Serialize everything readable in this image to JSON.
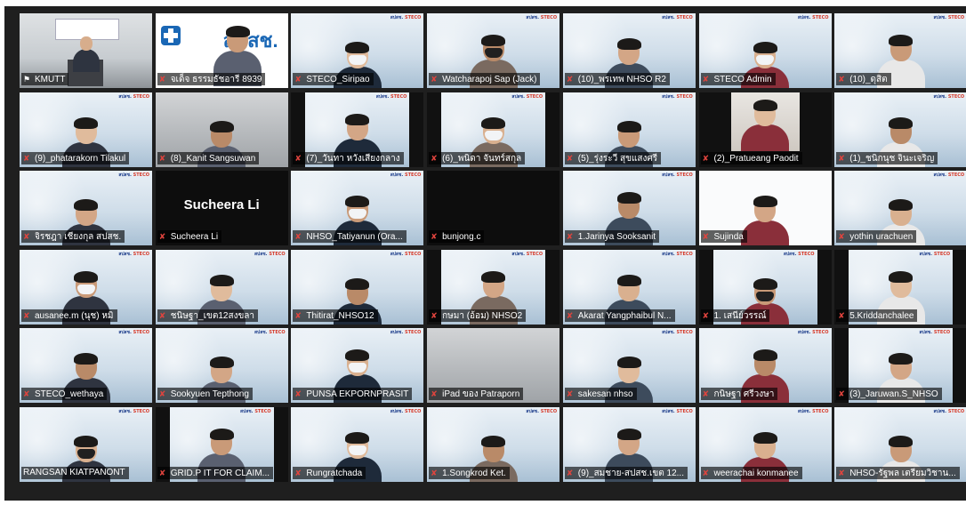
{
  "meeting": {
    "participants": [
      {
        "name": "KMUTT",
        "muted": false,
        "pinned": true,
        "speaking": true,
        "video": "room"
      },
      {
        "name": "จเด็จ ธรรมธัชอารี 8939",
        "muted": true,
        "video": "nhso-logo"
      },
      {
        "name": "STECO_Siripao",
        "muted": true,
        "video": "bg-mask"
      },
      {
        "name": "Watcharapoj Sap (Jack)",
        "muted": true,
        "video": "bg-blackmask"
      },
      {
        "name": "(10)_พรเทพ NHSO R2",
        "muted": true,
        "video": "bg-person"
      },
      {
        "name": "STECO Admin",
        "muted": true,
        "video": "bg-mask"
      },
      {
        "name": "(10)_ดุสิต",
        "muted": true,
        "video": "bg-person"
      },
      {
        "name": "(9)_phatarakorn Tilakul",
        "muted": true,
        "video": "bg-person"
      },
      {
        "name": "(8)_Kanit Sangsuwan",
        "muted": true,
        "video": "gray-person"
      },
      {
        "name": "(7)_วันทา หวังเสียงกลาง",
        "muted": true,
        "video": "bg-person-box"
      },
      {
        "name": "(6)_พนิดา จันทร์สกุล",
        "muted": true,
        "video": "bg-mask-box"
      },
      {
        "name": "(5)_รุ่งระวี สุขแสงศรี",
        "muted": true,
        "video": "bg-person"
      },
      {
        "name": "(2)_Pratueang Paodit",
        "muted": true,
        "video": "face"
      },
      {
        "name": "(1)_ชนิกนุช จินะเจริญ",
        "muted": true,
        "video": "bg-person"
      },
      {
        "name": "จิรชฎา เชียงกุล สปสช.",
        "muted": true,
        "video": "bg-person"
      },
      {
        "name": "Sucheera Li",
        "muted": true,
        "video": "off",
        "display_name": "Sucheera Li"
      },
      {
        "name": "NHSO_Tatiyanun (Ora...",
        "muted": true,
        "video": "bg-mask"
      },
      {
        "name": "bunjong.c",
        "muted": true,
        "video": "dark"
      },
      {
        "name": "1.Jarinya Sooksanit",
        "muted": true,
        "video": "bg-person"
      },
      {
        "name": "Sujinda",
        "muted": true,
        "video": "white-person"
      },
      {
        "name": "yothin urachuen",
        "muted": true,
        "video": "bg-person"
      },
      {
        "name": "ausanee.m (นุช) หมิ",
        "muted": true,
        "video": "bg-mask"
      },
      {
        "name": "ชนิษฐา_เขต12สงขลา",
        "muted": true,
        "video": "bg-person"
      },
      {
        "name": "Thitirat_NHSO12",
        "muted": true,
        "video": "bg-person"
      },
      {
        "name": "กษมา (อ้อม) NHSO2",
        "muted": true,
        "video": "bg-person-box"
      },
      {
        "name": "Akarat Yangphaibul N...",
        "muted": true,
        "video": "bg-person"
      },
      {
        "name": "1. เสนีย์วรรณ์",
        "muted": true,
        "video": "bg-blackmask-box"
      },
      {
        "name": "5.Kriddanchalee",
        "muted": true,
        "video": "bg-person-box"
      },
      {
        "name": "STECO_wethaya",
        "muted": true,
        "video": "bg-person"
      },
      {
        "name": "Sookyuen Tepthong",
        "muted": true,
        "video": "bg-person"
      },
      {
        "name": "PUNSA EKPORNPRASIT",
        "muted": true,
        "video": "bg-mask"
      },
      {
        "name": "iPad ของ Patraporn",
        "muted": true,
        "video": "gray"
      },
      {
        "name": "sakesan nhso",
        "muted": true,
        "video": "bg-person"
      },
      {
        "name": "กนิษฐา ศรีวงษา",
        "muted": true,
        "video": "bg-person"
      },
      {
        "name": "(3)_Jaruwan.S_NHSO",
        "muted": true,
        "video": "bg-person-box"
      },
      {
        "name": "RANGSAN KIATPANONT",
        "muted": false,
        "video": "bg-blackmask"
      },
      {
        "name": "GRID.P IT FOR CLAIM...",
        "muted": true,
        "video": "bg-person-box"
      },
      {
        "name": "Rungratchada",
        "muted": true,
        "video": "bg-mask"
      },
      {
        "name": "1.Songkrod Ket.",
        "muted": true,
        "video": "bg-person"
      },
      {
        "name": "(9)_สมชาย-สปสช.เขต 12...",
        "muted": true,
        "video": "bg-person"
      },
      {
        "name": "weerachai konmanee",
        "muted": true,
        "video": "bg-person"
      },
      {
        "name": "NHSO-รัฐพล เตรียมวิชาน...",
        "muted": true,
        "video": "bg-person"
      }
    ]
  },
  "branding": {
    "logo_left": "สปสช.",
    "logo_right": "STECO",
    "nhso_banner": "สปสช."
  },
  "colors": {
    "background": "#1f1f1f",
    "speaking_outline": "#e3d84a",
    "muted_icon": "#e0443e"
  }
}
